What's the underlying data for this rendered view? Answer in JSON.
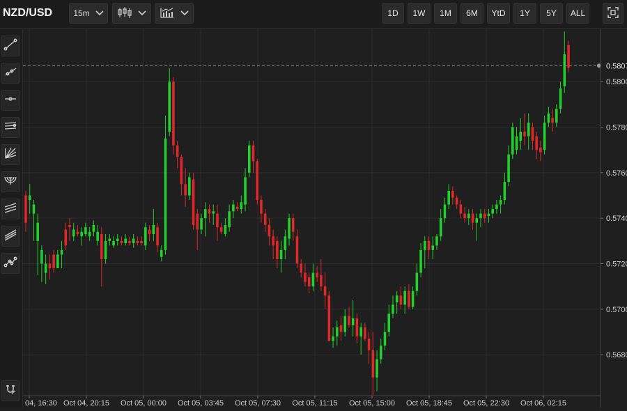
{
  "header": {
    "symbol": "NZD/USD",
    "interval": "15m",
    "ranges": [
      "1D",
      "1W",
      "1M",
      "6M",
      "YtD",
      "1Y",
      "5Y",
      "ALL"
    ]
  },
  "icons": {
    "chevron": "chevron-down-icon",
    "candle": "candlestick-icon",
    "indicator": "indicators-icon",
    "fullscreen": "fullscreen-icon",
    "tools": [
      "trend-line-icon",
      "ray-icon",
      "horizontal-line-icon",
      "parallel-channel-icon",
      "fan-icon",
      "arc-icon",
      "regression-icon",
      "pitchfork-icon",
      "path-icon",
      "magnet-icon"
    ]
  },
  "colors": {
    "up": "#22d12b",
    "down": "#e0272a",
    "background": "#1f1f1f",
    "grid": "#2c2c2c"
  },
  "chart_data": {
    "type": "candlestick",
    "ylim": [
      0.5662,
      0.5823
    ],
    "yticks": [
      0.568,
      0.57,
      0.572,
      0.574,
      0.576,
      0.578,
      0.58
    ],
    "ytick_labels": [
      "0.5680",
      "0.5700",
      "0.5720",
      "0.5740",
      "0.5760",
      "0.5780",
      "0.5800"
    ],
    "xtick_labels": [
      "04, 16:30",
      "Oct 04, 20:15",
      "Oct 05, 00:00",
      "Oct 05, 03:45",
      "Oct 05, 07:30",
      "Oct 05, 11:15",
      "Oct 05, 15:00",
      "Oct 05, 18:45",
      "Oct 05, 22:30",
      "Oct 06, 02:15"
    ],
    "last_price": 0.5807,
    "last_price_label": "0.5807",
    "candles": [
      [
        0.5734,
        0.575,
        0.5738,
        0.5752
      ],
      [
        0.5742,
        0.5748,
        0.575,
        0.5755
      ],
      [
        0.573,
        0.5742,
        0.5746,
        0.5748
      ],
      [
        0.5715,
        0.573,
        0.5738,
        0.5742
      ],
      [
        0.5712,
        0.572,
        0.5726,
        0.5728
      ],
      [
        0.5711,
        0.5716,
        0.572,
        0.5724
      ],
      [
        0.5713,
        0.572,
        0.5718,
        0.5724
      ],
      [
        0.5716,
        0.5724,
        0.5718,
        0.5726
      ],
      [
        0.5718,
        0.5718,
        0.5724,
        0.5726
      ],
      [
        0.5718,
        0.5724,
        0.5726,
        0.573
      ],
      [
        0.5726,
        0.5735,
        0.5728,
        0.5738
      ],
      [
        0.573,
        0.5737,
        0.5736,
        0.574
      ],
      [
        0.573,
        0.5732,
        0.5735,
        0.5738
      ],
      [
        0.5732,
        0.5734,
        0.5733,
        0.5737
      ],
      [
        0.5728,
        0.5732,
        0.5734,
        0.5736
      ],
      [
        0.5732,
        0.5733,
        0.5736,
        0.5738
      ],
      [
        0.573,
        0.5732,
        0.5734,
        0.5736
      ],
      [
        0.5732,
        0.5734,
        0.5737,
        0.5739
      ],
      [
        0.5728,
        0.573,
        0.5734,
        0.5737
      ],
      [
        0.571,
        0.5733,
        0.5722,
        0.5736
      ],
      [
        0.572,
        0.5722,
        0.573,
        0.5733
      ],
      [
        0.5728,
        0.573,
        0.5731,
        0.5733
      ],
      [
        0.5727,
        0.5728,
        0.573,
        0.5732
      ],
      [
        0.5728,
        0.573,
        0.5731,
        0.5733
      ],
      [
        0.5728,
        0.573,
        0.5729,
        0.5732
      ],
      [
        0.5728,
        0.5729,
        0.5731,
        0.5733
      ],
      [
        0.5728,
        0.573,
        0.5729,
        0.5732
      ],
      [
        0.5727,
        0.5729,
        0.5731,
        0.5733
      ],
      [
        0.5728,
        0.573,
        0.5729,
        0.5732
      ],
      [
        0.5728,
        0.573,
        0.5729,
        0.5732
      ],
      [
        0.5726,
        0.5728,
        0.5736,
        0.5738
      ],
      [
        0.573,
        0.5735,
        0.5733,
        0.5737
      ],
      [
        0.573,
        0.5733,
        0.5737,
        0.5744
      ],
      [
        0.5725,
        0.5736,
        0.5728,
        0.5738
      ],
      [
        0.5721,
        0.5723,
        0.5726,
        0.5728
      ],
      [
        0.5724,
        0.5726,
        0.5775,
        0.5785
      ],
      [
        0.5776,
        0.5778,
        0.58,
        0.5806
      ],
      [
        0.5768,
        0.58,
        0.5772,
        0.5802
      ],
      [
        0.5762,
        0.5772,
        0.5767,
        0.5774
      ],
      [
        0.575,
        0.5767,
        0.5755,
        0.5768
      ],
      [
        0.5745,
        0.5755,
        0.575,
        0.5762
      ],
      [
        0.5748,
        0.575,
        0.5758,
        0.576
      ],
      [
        0.5735,
        0.5757,
        0.5737,
        0.576
      ],
      [
        0.5726,
        0.5742,
        0.5735,
        0.5744
      ],
      [
        0.5733,
        0.5735,
        0.574,
        0.5742
      ],
      [
        0.5732,
        0.574,
        0.5744,
        0.5747
      ],
      [
        0.5738,
        0.5744,
        0.5742,
        0.5746
      ],
      [
        0.5737,
        0.5742,
        0.5743,
        0.5746
      ],
      [
        0.573,
        0.5742,
        0.5736,
        0.5746
      ],
      [
        0.5733,
        0.5736,
        0.5734,
        0.5738
      ],
      [
        0.5732,
        0.5733,
        0.5737,
        0.574
      ],
      [
        0.5734,
        0.5736,
        0.5743,
        0.5746
      ],
      [
        0.574,
        0.5743,
        0.5746,
        0.5748
      ],
      [
        0.5743,
        0.5745,
        0.5744,
        0.5747
      ],
      [
        0.5742,
        0.5744,
        0.5747,
        0.575
      ],
      [
        0.5743,
        0.5746,
        0.5758,
        0.5762
      ],
      [
        0.5758,
        0.576,
        0.5772,
        0.5774
      ],
      [
        0.576,
        0.5772,
        0.5765,
        0.5774
      ],
      [
        0.5746,
        0.5765,
        0.5748,
        0.5766
      ],
      [
        0.5738,
        0.5748,
        0.5742,
        0.575
      ],
      [
        0.5734,
        0.5742,
        0.5737,
        0.5744
      ],
      [
        0.5728,
        0.5737,
        0.5732,
        0.574
      ],
      [
        0.5722,
        0.5732,
        0.5728,
        0.5735
      ],
      [
        0.5718,
        0.573,
        0.5722,
        0.5732
      ],
      [
        0.5716,
        0.5722,
        0.5726,
        0.573
      ],
      [
        0.5722,
        0.5726,
        0.5732,
        0.5735
      ],
      [
        0.5728,
        0.5731,
        0.574,
        0.5742
      ],
      [
        0.573,
        0.574,
        0.5734,
        0.5742
      ],
      [
        0.5718,
        0.5732,
        0.572,
        0.5735
      ],
      [
        0.5714,
        0.572,
        0.5716,
        0.5722
      ],
      [
        0.571,
        0.5716,
        0.5712,
        0.572
      ],
      [
        0.5707,
        0.5714,
        0.571,
        0.5716
      ],
      [
        0.5708,
        0.571,
        0.5716,
        0.572
      ],
      [
        0.5712,
        0.5716,
        0.5714,
        0.5719
      ],
      [
        0.5708,
        0.5715,
        0.571,
        0.5722
      ],
      [
        0.57,
        0.571,
        0.5706,
        0.5716
      ],
      [
        0.569,
        0.5706,
        0.5686,
        0.5708
      ],
      [
        0.5683,
        0.5686,
        0.5688,
        0.5692
      ],
      [
        0.5684,
        0.5688,
        0.5692,
        0.5695
      ],
      [
        0.5686,
        0.5693,
        0.569,
        0.5697
      ],
      [
        0.5688,
        0.569,
        0.5697,
        0.57
      ],
      [
        0.5692,
        0.5697,
        0.5693,
        0.5701
      ],
      [
        0.5688,
        0.5693,
        0.5696,
        0.5704
      ],
      [
        0.5685,
        0.5696,
        0.5688,
        0.5698
      ],
      [
        0.568,
        0.5688,
        0.5692,
        0.5694
      ],
      [
        0.5686,
        0.5692,
        0.5687,
        0.5694
      ],
      [
        0.5676,
        0.5687,
        0.5682,
        0.569
      ],
      [
        0.5662,
        0.5682,
        0.567,
        0.569
      ],
      [
        0.5664,
        0.567,
        0.5678,
        0.5682
      ],
      [
        0.5676,
        0.5678,
        0.5684,
        0.5687
      ],
      [
        0.5682,
        0.5684,
        0.569,
        0.5694
      ],
      [
        0.5688,
        0.569,
        0.5698,
        0.5702
      ],
      [
        0.5696,
        0.5698,
        0.5702,
        0.5706
      ],
      [
        0.5698,
        0.5703,
        0.5706,
        0.5708
      ],
      [
        0.57,
        0.5706,
        0.5702,
        0.571
      ],
      [
        0.5698,
        0.5702,
        0.5708,
        0.571
      ],
      [
        0.57,
        0.5708,
        0.5701,
        0.5711
      ],
      [
        0.57,
        0.5701,
        0.5708,
        0.571
      ],
      [
        0.5706,
        0.5708,
        0.5716,
        0.572
      ],
      [
        0.5714,
        0.5716,
        0.5726,
        0.5729
      ],
      [
        0.5718,
        0.5726,
        0.573,
        0.5732
      ],
      [
        0.5722,
        0.573,
        0.5726,
        0.5732
      ],
      [
        0.5722,
        0.5726,
        0.5728,
        0.5732
      ],
      [
        0.5726,
        0.5728,
        0.5732,
        0.5733
      ],
      [
        0.573,
        0.5732,
        0.574,
        0.5744
      ],
      [
        0.5738,
        0.574,
        0.5746,
        0.5749
      ],
      [
        0.5744,
        0.5746,
        0.5752,
        0.5755
      ],
      [
        0.5746,
        0.5752,
        0.5749,
        0.5754
      ],
      [
        0.5744,
        0.5749,
        0.5746,
        0.575
      ],
      [
        0.574,
        0.5746,
        0.5742,
        0.5748
      ],
      [
        0.5738,
        0.5742,
        0.574,
        0.5745
      ],
      [
        0.5737,
        0.574,
        0.5742,
        0.5744
      ],
      [
        0.5735,
        0.5742,
        0.5738,
        0.5744
      ],
      [
        0.573,
        0.5738,
        0.574,
        0.5742
      ],
      [
        0.5736,
        0.574,
        0.5742,
        0.5744
      ],
      [
        0.5738,
        0.5742,
        0.574,
        0.5744
      ],
      [
        0.5738,
        0.5741,
        0.5742,
        0.5744
      ],
      [
        0.574,
        0.5742,
        0.5744,
        0.5746
      ],
      [
        0.5742,
        0.5744,
        0.5746,
        0.5748
      ],
      [
        0.5742,
        0.5746,
        0.5748,
        0.575
      ],
      [
        0.5746,
        0.5748,
        0.5756,
        0.576
      ],
      [
        0.5754,
        0.5756,
        0.5768,
        0.5772
      ],
      [
        0.5766,
        0.5768,
        0.578,
        0.5782
      ],
      [
        0.5768,
        0.577,
        0.5776,
        0.578
      ],
      [
        0.577,
        0.5774,
        0.5778,
        0.5784
      ],
      [
        0.5772,
        0.5778,
        0.5776,
        0.5786
      ],
      [
        0.577,
        0.5776,
        0.5782,
        0.5786
      ],
      [
        0.577,
        0.578,
        0.5774,
        0.5782
      ],
      [
        0.5766,
        0.5776,
        0.577,
        0.5778
      ],
      [
        0.5765,
        0.5771,
        0.5769,
        0.5774
      ],
      [
        0.5768,
        0.577,
        0.5782,
        0.5785
      ],
      [
        0.578,
        0.5782,
        0.5786,
        0.5789
      ],
      [
        0.5778,
        0.5784,
        0.5782,
        0.5788
      ],
      [
        0.578,
        0.5782,
        0.5788,
        0.579
      ],
      [
        0.5786,
        0.5788,
        0.5797,
        0.58
      ],
      [
        0.5795,
        0.5798,
        0.5812,
        0.5822
      ],
      [
        0.5804,
        0.5816,
        0.5806,
        0.5818
      ]
    ]
  }
}
